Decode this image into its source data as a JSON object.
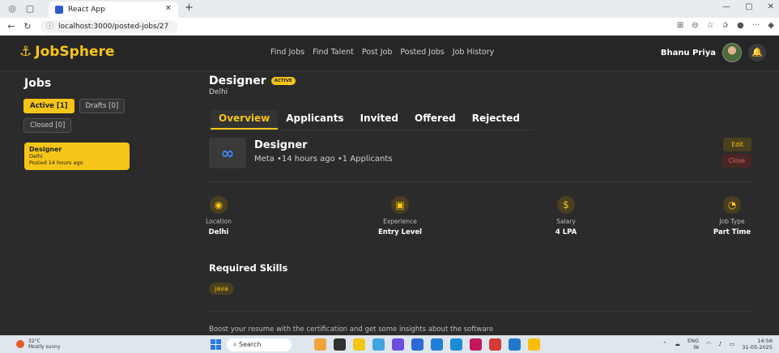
{
  "browser": {
    "tab_title": "React App",
    "url": "localhost:3000/posted-jobs/27"
  },
  "header": {
    "logo": "JobSphere",
    "menu": [
      "Find Jobs",
      "Find Talent",
      "Post Job",
      "Posted Jobs",
      "Job History"
    ],
    "user_name": "Bhanu Priya"
  },
  "sidebar": {
    "title": "Jobs",
    "filters": [
      {
        "label": "Active [1]",
        "active": true
      },
      {
        "label": "Drafts [0]",
        "active": false
      },
      {
        "label": "Closed [0]",
        "active": false
      }
    ],
    "job_card": {
      "title": "Designer",
      "location": "Delhi",
      "posted": "Posted 14 hours ago"
    }
  },
  "job": {
    "title": "Designer",
    "status": "ACTIVE",
    "location": "Delhi",
    "tabs": [
      "Overview",
      "Applicants",
      "Invited",
      "Offered",
      "Rejected"
    ],
    "selected_tab": "Overview",
    "company_title": "Designer",
    "company_meta": "Meta •14 hours ago •1 Applicants",
    "edit_label": "Edit",
    "close_label": "Close",
    "stats": [
      {
        "label": "Location",
        "value": "Delhi",
        "icon": "location-pin-icon"
      },
      {
        "label": "Experience",
        "value": "Entry Level",
        "icon": "briefcase-icon"
      },
      {
        "label": "Salary",
        "value": "4 LPA",
        "icon": "coin-icon"
      },
      {
        "label": "Job Type",
        "value": "Part Time",
        "icon": "clock-icon"
      }
    ],
    "skills_title": "Required Skills",
    "skills": [
      "java"
    ],
    "boost_text": "Boost your resume with the certification and get some insights about the software"
  },
  "taskbar": {
    "temp": "32°C",
    "weather": "Mostly sunny",
    "search_label": "Search",
    "lang": "ENG",
    "region": "IN",
    "time": "14:56",
    "date": "31-05-2025"
  },
  "colors": {
    "accent": "#f5c518",
    "background": "#2b2b2b",
    "danger": "#e06060"
  }
}
